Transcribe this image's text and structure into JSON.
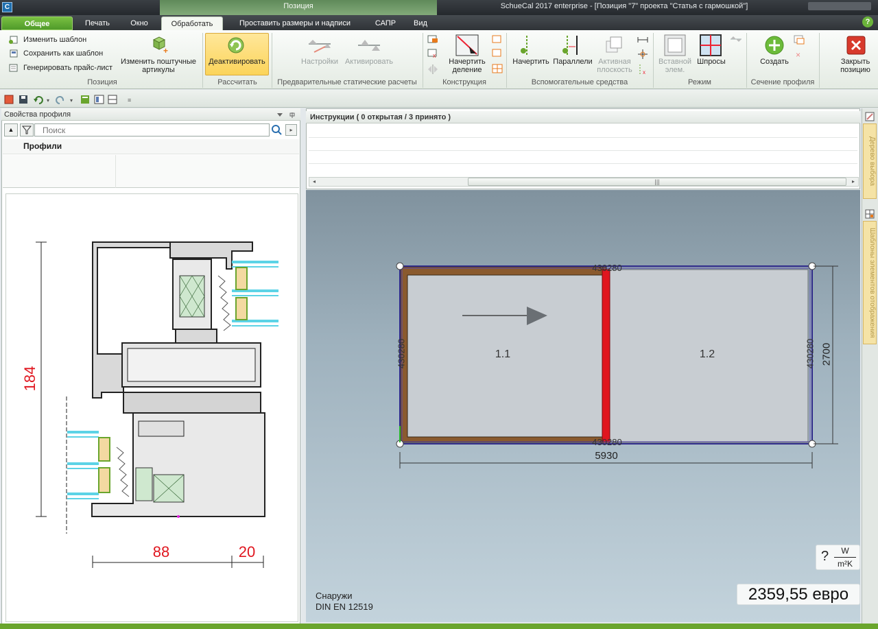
{
  "window": {
    "title": "SchueCal 2017 enterprise - [Позиция \"7\" проекта \"Статья с гармошкой\"]",
    "context_tab_group": "Позиция"
  },
  "tabs": [
    "Общее",
    "Печать",
    "Окно",
    "Обработать",
    "Проставить размеры и надписи",
    "САПР",
    "Вид"
  ],
  "active_tab": "Обработать",
  "ribbon": {
    "position": {
      "label": "Позиция",
      "edit_template": "Изменить шаблон",
      "save_template": "Сохранить как шаблон",
      "generate_price": "Генерировать прайс-лист",
      "edit_articles": "Изменить поштучные артикулы"
    },
    "calculate": {
      "label": "Рассчитать",
      "deactivate": "Деактивировать"
    },
    "static": {
      "label": "Предварительные статические расчеты",
      "settings": "Настройки",
      "activate": "Активировать"
    },
    "construction": {
      "label": "Конструкция",
      "draw_division": "Начертить деление"
    },
    "aux": {
      "label": "Вспомогательные средства",
      "draw": "Начертить",
      "parallel": "Параллели",
      "active_plane": "Активная плоскость"
    },
    "mode": {
      "label": "Режим",
      "insert_elem": "Вставной элем.",
      "muntins": "Шпросы"
    },
    "section": {
      "label": "Сечение профиля",
      "create": "Создать"
    },
    "close": {
      "label": "Закрыть позицию"
    }
  },
  "left_panel": {
    "title": "Свойства профиля",
    "search_placeholder": "Поиск",
    "profiles_header": "Профили",
    "dims": {
      "height": "184",
      "width_a": "88",
      "width_b": "20"
    }
  },
  "instructions": {
    "title": "Инструкции ( 0 открытая / 3 принято )"
  },
  "viewport": {
    "pane_left": "1.1",
    "pane_right": "1.2",
    "profile_code": "430280",
    "width_dim": "5930",
    "height_dim": "2700",
    "outside_label": "Снаружи",
    "standard": "DIN EN 12519",
    "u_value_q": "?",
    "u_num": "W",
    "u_den": "m²K",
    "price": "2359,55 евро"
  },
  "right_rail": {
    "tab1": "Дерево выбора",
    "tab2": "Шаблоны элементов отображения"
  },
  "colors": {
    "accent_green": "#6aa52d",
    "frame_brown": "#8a5a2e",
    "divider_red": "#e0161f",
    "outline_blue": "#2f2a8a"
  }
}
